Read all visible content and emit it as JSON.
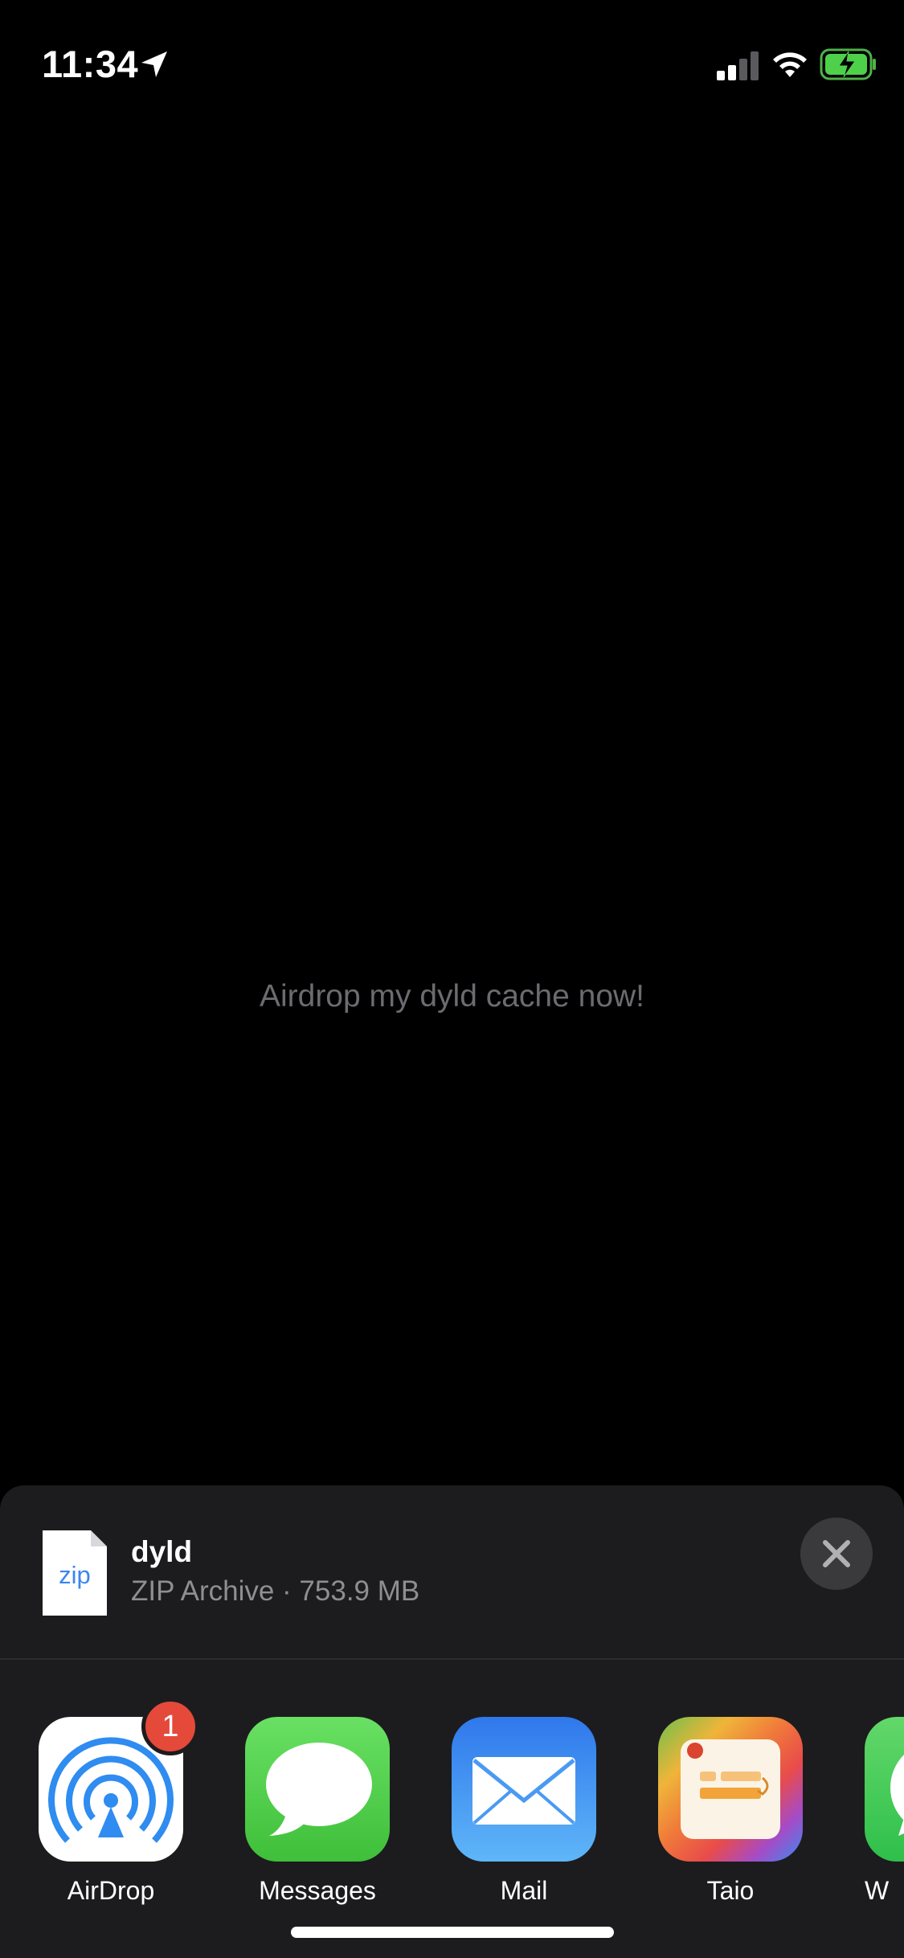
{
  "status_bar": {
    "time": "11:34",
    "icons": [
      "location-arrow-icon",
      "cellular-signal-icon",
      "wifi-icon",
      "battery-charging-icon"
    ]
  },
  "main": {
    "message": "Airdrop my dyld cache now!"
  },
  "share_sheet": {
    "file": {
      "icon_label": "zip",
      "name": "dyld",
      "meta": "ZIP Archive · 753.9 MB"
    },
    "close_icon": "close-icon",
    "apps": [
      {
        "label": "AirDrop",
        "icon": "airdrop-icon",
        "badge": "1"
      },
      {
        "label": "Messages",
        "icon": "messages-icon"
      },
      {
        "label": "Mail",
        "icon": "mail-icon"
      },
      {
        "label": "Taio",
        "icon": "taio-icon"
      },
      {
        "label": "W",
        "icon": "whatsapp-icon"
      }
    ]
  },
  "colors": {
    "background": "#000000",
    "sheet": "#1c1c1e",
    "badge": "#e5493a",
    "messages_green": "#5ed25a",
    "mail_blue": "#3a8bf0",
    "airdrop_blue": "#2f8cf0"
  }
}
